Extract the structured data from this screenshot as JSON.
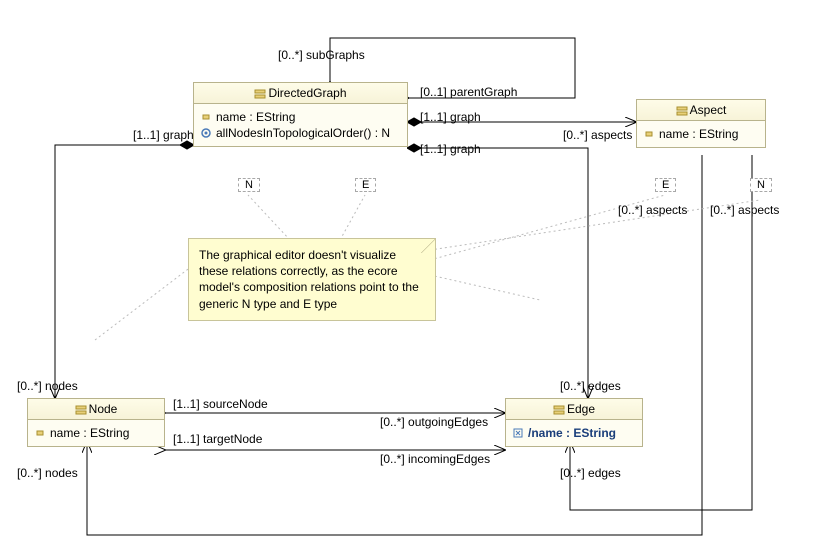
{
  "classes": {
    "DirectedGraph": {
      "name": "DirectedGraph",
      "attrs": [
        "name : EString"
      ],
      "ops": [
        "allNodesInTopologicalOrder() : N"
      ],
      "params": [
        "N",
        "E"
      ]
    },
    "Aspect": {
      "name": "Aspect",
      "attrs": [
        "name : EString"
      ],
      "params": [
        "E",
        "N"
      ]
    },
    "Node": {
      "name": "Node",
      "attrs": [
        "name : EString"
      ]
    },
    "Edge": {
      "name": "Edge",
      "derived_attr": "/name : EString"
    }
  },
  "note": "The graphical editor doesn't visualize these relations correctly, as the ecore model's composition relations point to the generic N type and E type",
  "labels": {
    "subGraphs": "[0..*] subGraphs",
    "parentGraph": "[0..1] parentGraph",
    "graph11_left": "[1..1] graph",
    "graph11_a": "[1..1] graph",
    "graph11_b": "[1..1] graph",
    "aspects_right": "[0..*] aspects",
    "aspects_down1": "[0..*] aspects",
    "aspects_down2": "[0..*] aspects",
    "nodes_top": "[0..*] nodes",
    "nodes_bottom": "[0..*] nodes",
    "edges_top": "[0..*] edges",
    "edges_bottom": "[0..*] edges",
    "sourceNode": "[1..1] sourceNode",
    "outgoingEdges": "[0..*] outgoingEdges",
    "targetNode": "[1..1] targetNode",
    "incomingEdges": "[0..*] incomingEdges"
  },
  "chart_data": {
    "type": "diagram",
    "classes": [
      {
        "id": "DirectedGraph",
        "name": "DirectedGraph",
        "attributes": [
          "name : EString"
        ],
        "operations": [
          "allNodesInTopologicalOrder() : N"
        ],
        "type_parameters": [
          "N",
          "E"
        ]
      },
      {
        "id": "Aspect",
        "name": "Aspect",
        "attributes": [
          "name : EString"
        ],
        "type_parameters": [
          "E",
          "N"
        ]
      },
      {
        "id": "Node",
        "name": "Node",
        "attributes": [
          "name : EString"
        ]
      },
      {
        "id": "Edge",
        "name": "Edge",
        "attributes": [
          "/name : EString"
        ]
      }
    ],
    "associations": [
      {
        "from": "DirectedGraph",
        "to": "DirectedGraph",
        "end1": "[0..*] subGraphs",
        "end2": "[0..1] parentGraph",
        "composition": true
      },
      {
        "from": "DirectedGraph",
        "to": "Node",
        "end1": "[1..1] graph",
        "end2": "[0..*] nodes",
        "composition": true
      },
      {
        "from": "DirectedGraph",
        "to": "Edge",
        "end1": "[1..1] graph",
        "end2": "[0..*] edges",
        "composition": true
      },
      {
        "from": "DirectedGraph",
        "to": "Aspect",
        "end1": "[1..1] graph",
        "end2": "[0..*] aspects",
        "composition": true
      },
      {
        "from": "Edge",
        "to": "Node",
        "end1": "[0..*] outgoingEdges",
        "end2": "[1..1] sourceNode"
      },
      {
        "from": "Edge",
        "to": "Node",
        "end1": "[0..*] incomingEdges",
        "end2": "[1..1] targetNode"
      },
      {
        "from": "Aspect",
        "to": "Node",
        "end2": "[0..*] nodes"
      },
      {
        "from": "Aspect",
        "to": "Edge",
        "end2": "[0..*] edges"
      }
    ],
    "note": "The graphical editor doesn't visualize these relations correctly, as the ecore model's composition relations point to the generic N type and E type"
  }
}
